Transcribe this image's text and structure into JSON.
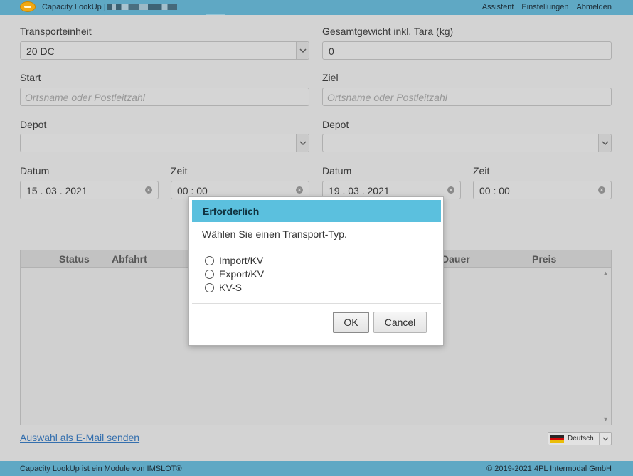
{
  "header": {
    "app_title": "Capacity LookUp |",
    "nav": [
      "Assistent",
      "Einstellungen",
      "Abmelden"
    ]
  },
  "form": {
    "transport_label": "Transporteinheit",
    "transport_value": "20 DC",
    "weight_label": "Gesamtgewicht inkl. Tara (kg)",
    "weight_value": "0",
    "start_label": "Start",
    "start_placeholder": "Ortsname oder Postleitzahl",
    "ziel_label": "Ziel",
    "ziel_placeholder": "Ortsname oder Postleitzahl",
    "depot_left_label": "Depot",
    "depot_right_label": "Depot",
    "datum_left_label": "Datum",
    "datum_left_value": "15 . 03 . 2021",
    "zeit_left_label": "Zeit",
    "zeit_left_value": "00 : 00",
    "datum_right_label": "Datum",
    "datum_right_value": "19 . 03 . 2021",
    "zeit_right_label": "Zeit",
    "zeit_right_value": "00 : 00"
  },
  "table": {
    "columns": [
      "Status",
      "Abfahrt",
      "Dauer",
      "Preis"
    ]
  },
  "email_link": "Auswahl als E-Mail senden",
  "language": "Deutsch",
  "footer": {
    "left": "Capacity LookUp ist ein Module von IMSLOT®",
    "right": "© 2019-2021 4PL Intermodal GmbH"
  },
  "dialog": {
    "title": "Erforderlich",
    "message": "Wählen Sie einen Transport-Typ.",
    "options": [
      "Import/KV",
      "Export/KV",
      "KV-S"
    ],
    "ok_label": "OK",
    "cancel_label": "Cancel"
  },
  "colors": {
    "header_bar": "#5fa8c4",
    "dialog_header": "#5bc0de",
    "link": "#2f6fb3"
  }
}
